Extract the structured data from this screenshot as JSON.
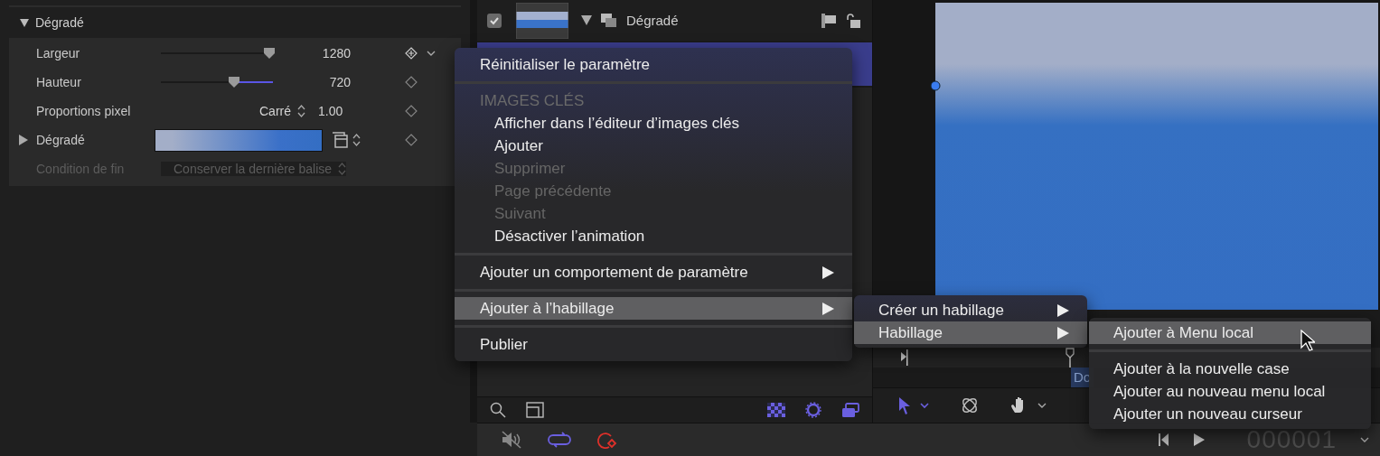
{
  "inspector": {
    "group": {
      "title": "Dégradé",
      "expanded": true
    },
    "rows": [
      {
        "kind": "slider",
        "label": "Largeur",
        "level": 0.97,
        "value": "1280",
        "modified": false,
        "hovered": true,
        "disabled": false
      },
      {
        "kind": "slider",
        "label": "Hauteur",
        "level": 0.65,
        "value": "720",
        "modified": true,
        "hovered": false,
        "disabled": false
      },
      {
        "kind": "popup",
        "label": "Proportions pixel",
        "option": "Carré",
        "value": "1.00",
        "disabled": false
      },
      {
        "kind": "gradient",
        "label": "Dégradé",
        "expanded": false,
        "disabled": false
      },
      {
        "kind": "popup",
        "label": "Condition de fin",
        "option": "Conserver la dernière balise",
        "disabled": true
      }
    ]
  },
  "layers": [
    {
      "name": "Dégradé",
      "checked": true,
      "expanded": true,
      "selected": false
    },
    {
      "selected": true
    }
  ],
  "timeline": {
    "clip_label": "Do"
  },
  "timecode": "000001",
  "menus": [
    {
      "items": [
        {
          "kind": "item",
          "label": "Réinitialiser le paramètre",
          "selected": false,
          "disabled": false,
          "submenu": false
        },
        {
          "kind": "separator"
        },
        {
          "kind": "header",
          "label": "IMAGES CLÉS"
        },
        {
          "kind": "subitem",
          "label": "Afficher dans l’éditeur d’images clés",
          "selected": false,
          "disabled": false,
          "submenu": false
        },
        {
          "kind": "subitem",
          "label": "Ajouter",
          "selected": false,
          "disabled": false,
          "submenu": false
        },
        {
          "kind": "subitem",
          "label": "Supprimer",
          "selected": false,
          "disabled": true,
          "submenu": false
        },
        {
          "kind": "subitem",
          "label": "Page précédente",
          "selected": false,
          "disabled": true,
          "submenu": false
        },
        {
          "kind": "subitem",
          "label": "Suivant",
          "selected": false,
          "disabled": true,
          "submenu": false
        },
        {
          "kind": "subitem",
          "label": "Désactiver l’animation",
          "selected": false,
          "disabled": false,
          "submenu": false
        },
        {
          "kind": "separator"
        },
        {
          "kind": "item",
          "label": "Ajouter un comportement de paramètre",
          "selected": false,
          "disabled": false,
          "submenu": true
        },
        {
          "kind": "separator"
        },
        {
          "kind": "item",
          "label": "Ajouter à l’habillage",
          "selected": true,
          "disabled": false,
          "submenu": true
        },
        {
          "kind": "separator"
        },
        {
          "kind": "item",
          "label": "Publier",
          "selected": false,
          "disabled": false,
          "submenu": false
        }
      ]
    },
    {
      "items": [
        {
          "kind": "item",
          "label": "Créer un habillage",
          "selected": false,
          "disabled": false,
          "submenu": true
        },
        {
          "kind": "item",
          "label": "Habillage",
          "selected": true,
          "disabled": false,
          "submenu": true
        }
      ]
    },
    {
      "items": [
        {
          "kind": "item",
          "label": "Ajouter à Menu local",
          "selected": true,
          "disabled": false,
          "submenu": false
        },
        {
          "kind": "separator"
        },
        {
          "kind": "item",
          "label": "Ajouter à la nouvelle case",
          "selected": false,
          "disabled": false,
          "submenu": false
        },
        {
          "kind": "item",
          "label": "Ajouter au nouveau menu local",
          "selected": false,
          "disabled": false,
          "submenu": false
        },
        {
          "kind": "item",
          "label": "Ajouter un nouveau curseur",
          "selected": false,
          "disabled": false,
          "submenu": false
        }
      ]
    }
  ]
}
